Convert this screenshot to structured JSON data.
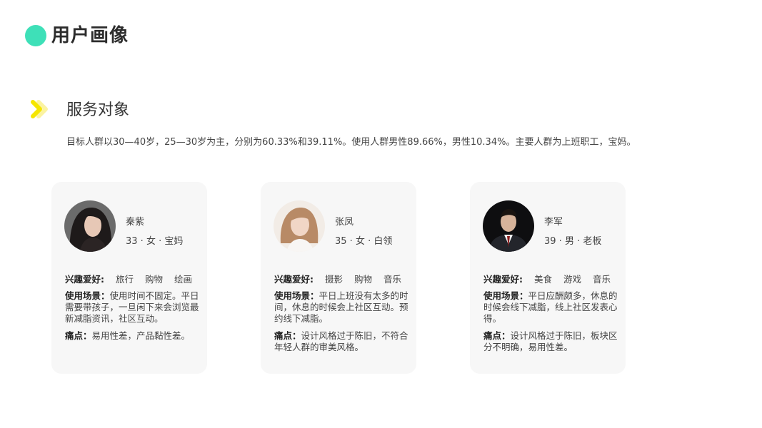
{
  "header": {
    "title": "用户画像"
  },
  "section": {
    "title": "服务对象",
    "summary": "目标人群以30—40岁，25—30岁为主，分别为60.33%和39.11%。使用人群男性89.66%，男性10.34%。主要人群为上班职工，宝妈。"
  },
  "colors": {
    "accent_green": "#3ee0b8",
    "accent_yellow": "#f5e600"
  },
  "personas": [
    {
      "name": "秦紫",
      "meta": "33 · 女 · 宝妈",
      "hobby_label": "兴趣爱好",
      "hobbies": [
        "旅行",
        "购物",
        "绘画"
      ],
      "scene_label": "使用场景",
      "scene": "使用时间不固定。平日需要带孩子，一旦闲下来会浏览最新减脂资讯，社区互动。",
      "pain_label": "痛点",
      "pain": "易用性差，产品黏性差。"
    },
    {
      "name": "张凤",
      "meta": "35 · 女 · 白领",
      "hobby_label": "兴趣爱好",
      "hobbies": [
        "摄影",
        "购物",
        "音乐"
      ],
      "scene_label": "使用场景",
      "scene": "平日上班没有太多的时间，休息的时候会上社区互动。预约线下减脂。",
      "pain_label": "痛点",
      "pain": "设计风格过于陈旧，不符合年轻人群的审美风格。"
    },
    {
      "name": "李军",
      "meta": "39 · 男 · 老板",
      "hobby_label": "兴趣爱好",
      "hobbies": [
        "美食",
        "游戏",
        "音乐"
      ],
      "scene_label": "使用场景",
      "scene": "平日应酬颇多，休息的时候会线下减脂，线上社区发表心得。",
      "pain_label": "痛点",
      "pain": "设计风格过于陈旧，板块区分不明确，易用性差。"
    }
  ]
}
